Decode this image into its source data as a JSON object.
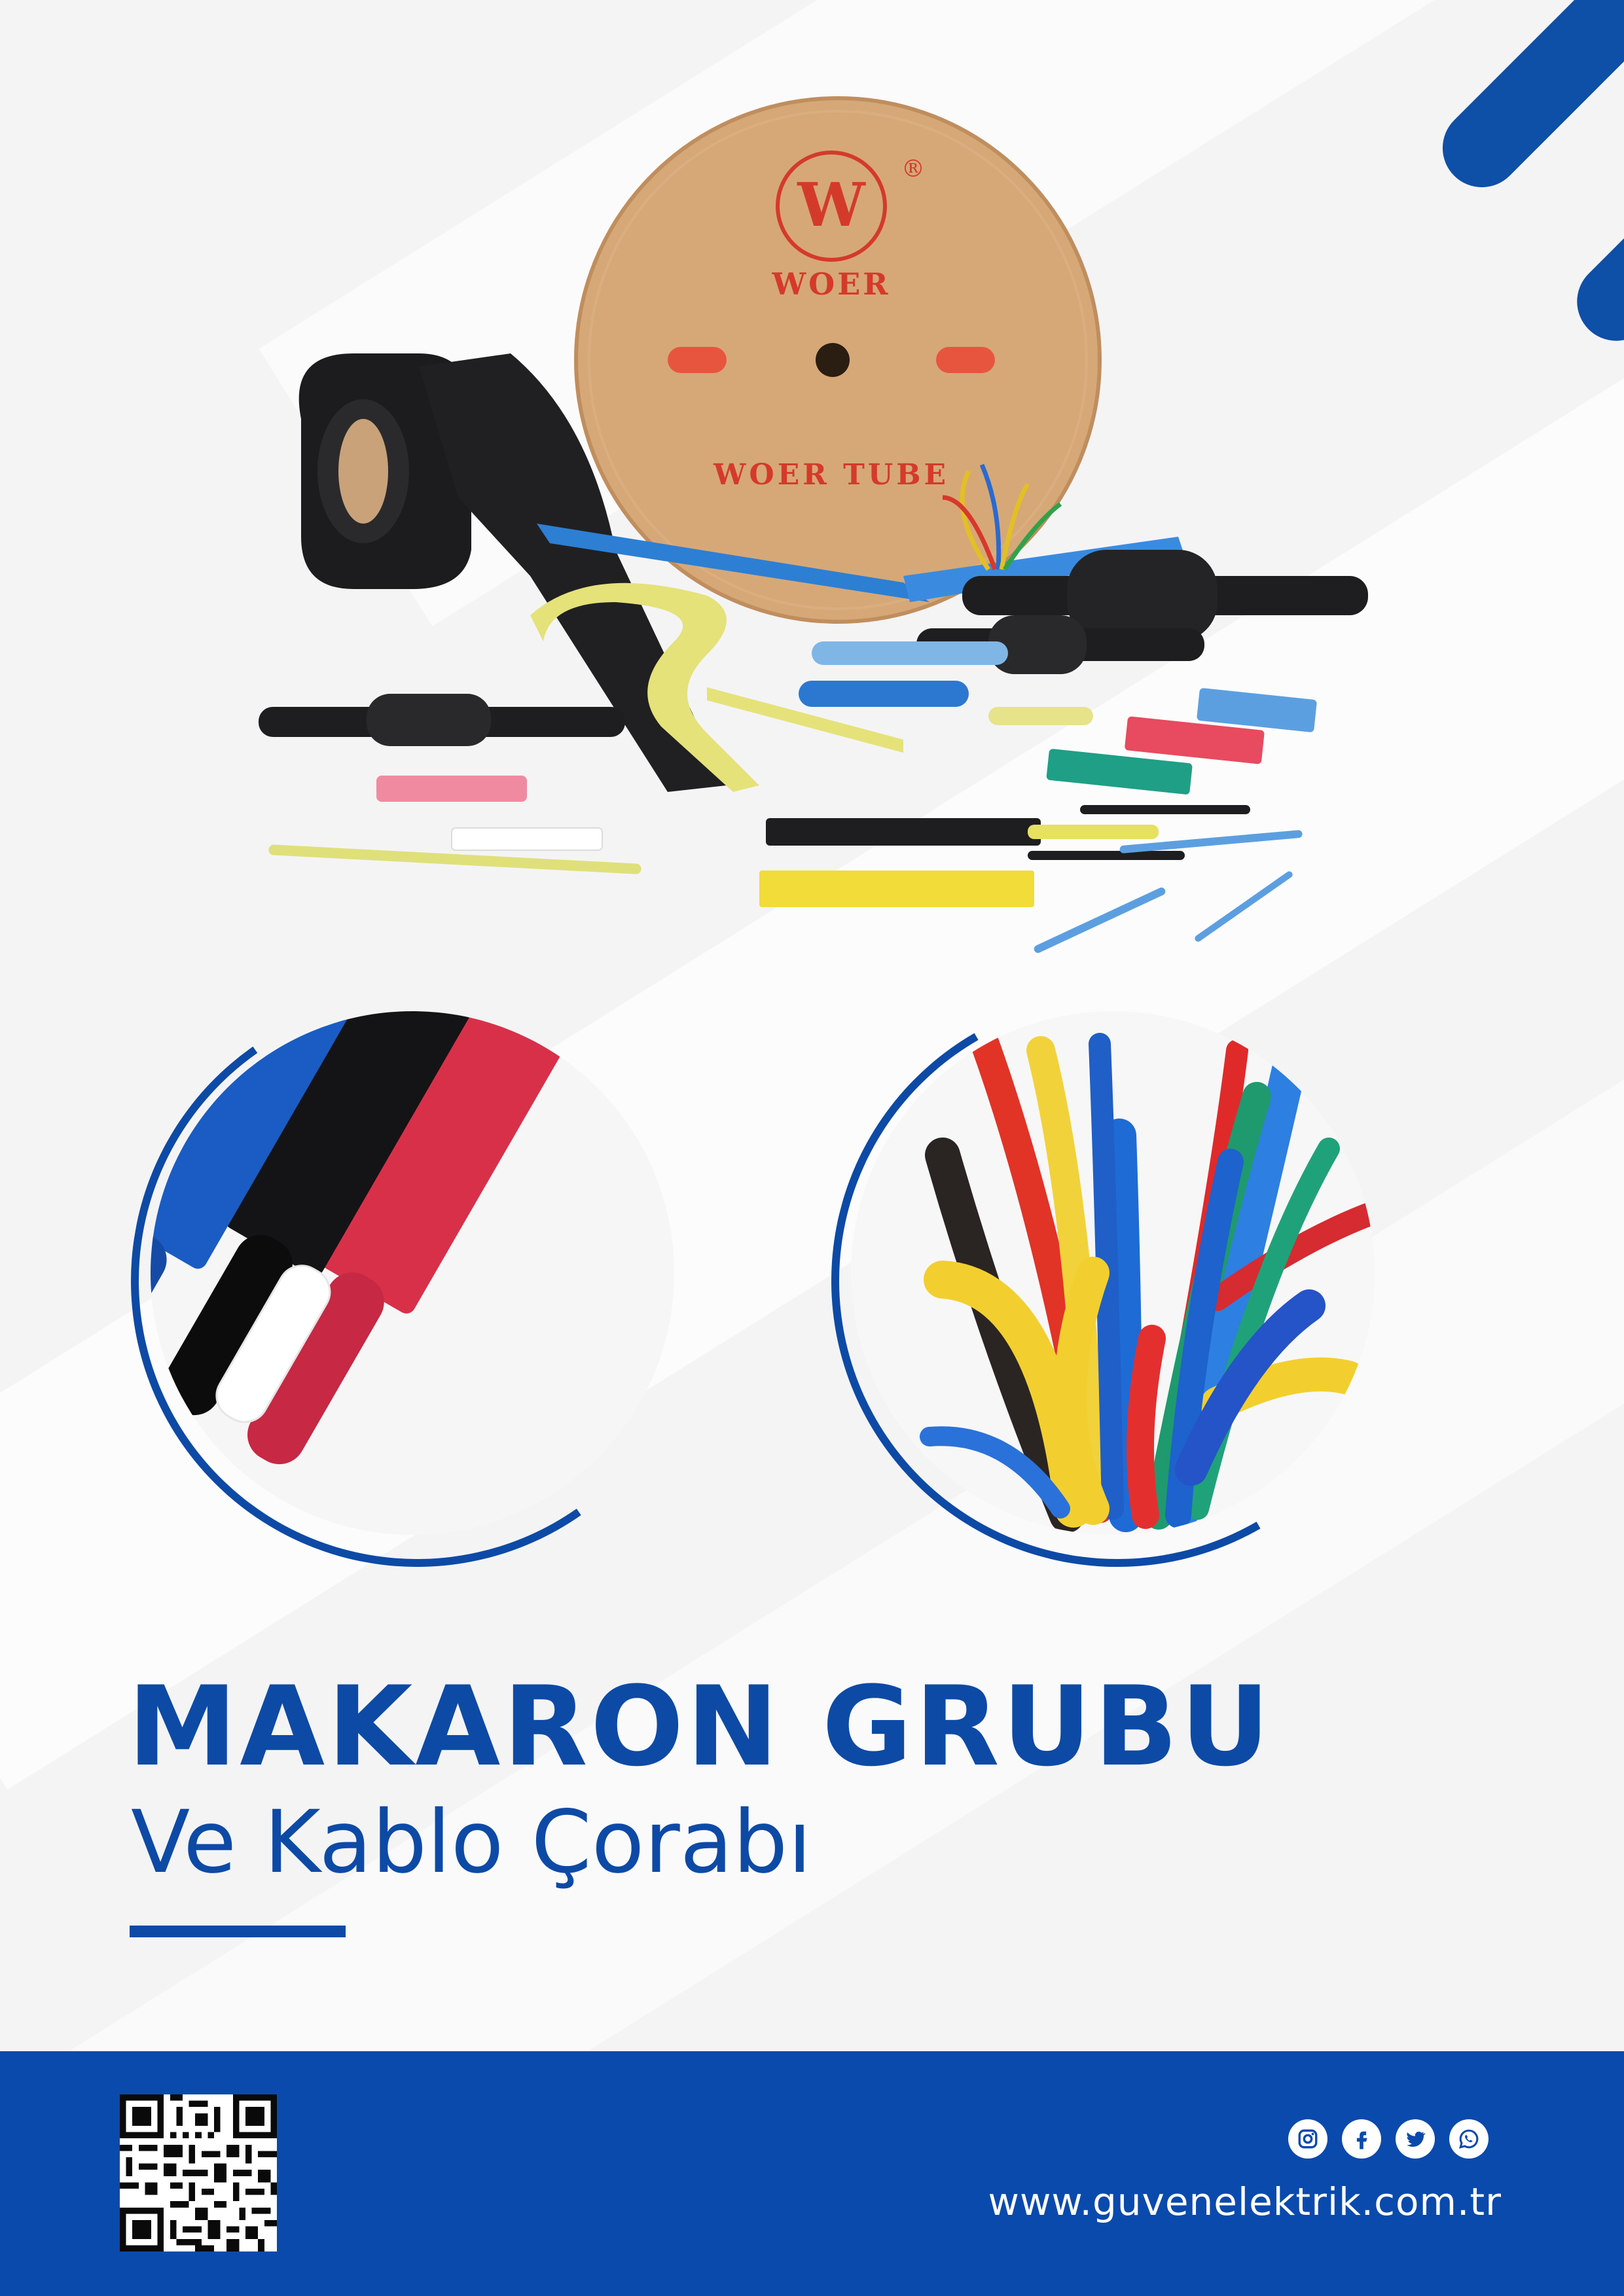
{
  "hero": {
    "spool_brand_mark": "W",
    "spool_brand": "WOER",
    "spool_registered": "®",
    "spool_label": "WOER TUBE"
  },
  "headline": {
    "title": "MAKARON GRUBU",
    "subtitle": "Ve Kablo Çorabı"
  },
  "footer": {
    "website": "www.guvenelektrik.com.tr",
    "social_icons": [
      "instagram-icon",
      "facebook-icon",
      "twitter-icon",
      "whatsapp-icon"
    ]
  },
  "colors": {
    "brand_blue": "#0d4aa6",
    "footer_blue": "#0a4aad",
    "background": "#f4f4f5"
  }
}
